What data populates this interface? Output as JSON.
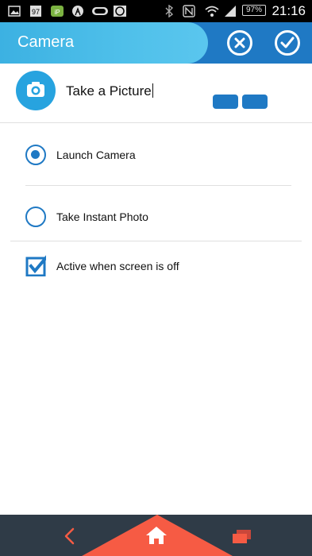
{
  "status_bar": {
    "time": "21:16",
    "battery": "97%",
    "notification_badge": "97"
  },
  "app_bar": {
    "title": "Camera",
    "cancel_icon": "cancel-circle-icon",
    "confirm_icon": "check-circle-icon"
  },
  "task": {
    "icon": "camera-icon",
    "name": "Take a Picture"
  },
  "options": [
    {
      "label": "Launch Camera",
      "selected": true
    },
    {
      "label": "Take Instant Photo",
      "selected": false
    }
  ],
  "screen_off": {
    "label": "Active when screen is off",
    "checked": true
  },
  "bottom_nav": {
    "back_icon": "chevron-left-icon",
    "home_icon": "home-icon",
    "windows_icon": "recent-windows-icon"
  },
  "colors": {
    "primary": "#1f79c4",
    "appbar_light": "#4fc0ea",
    "avatar": "#27a3df",
    "nav_bg": "#2f3b47",
    "accent": "#f65b44"
  }
}
